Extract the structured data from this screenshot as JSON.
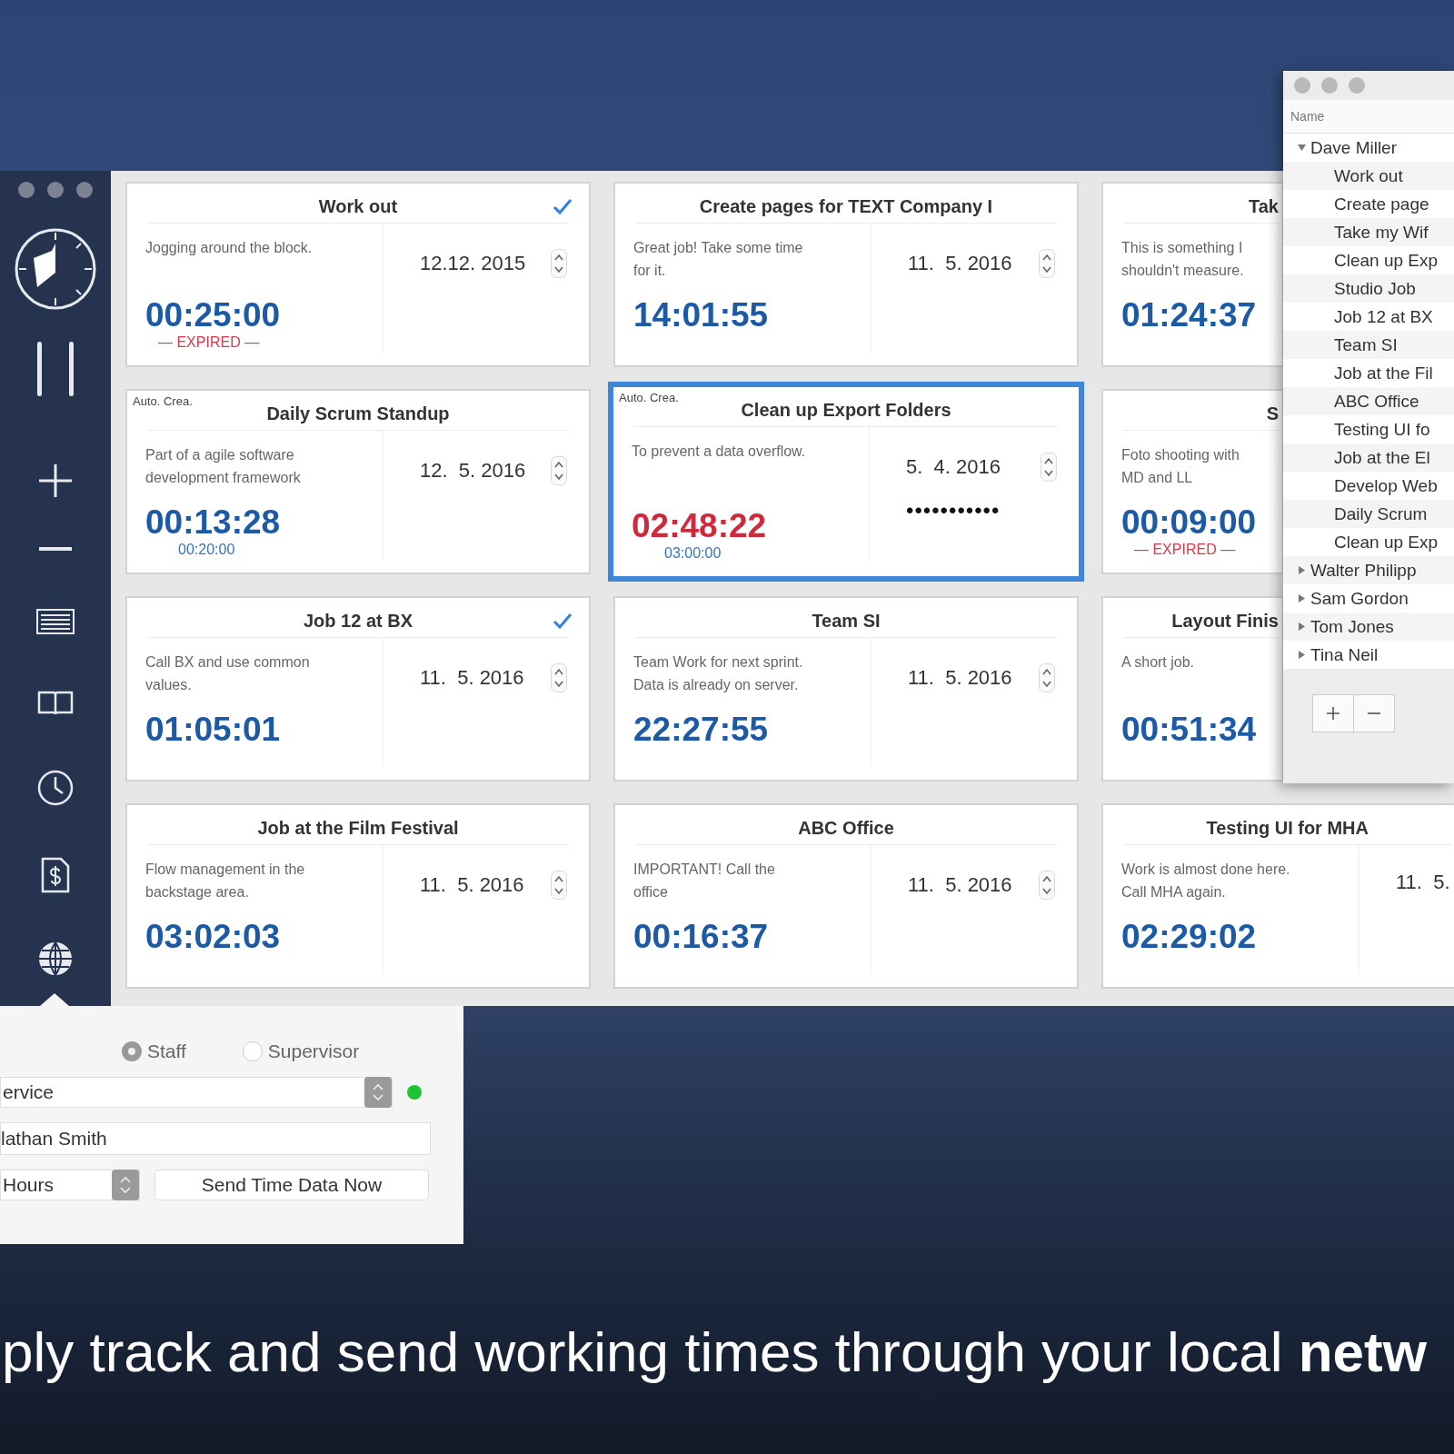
{
  "cards": [
    {
      "title": "Work out",
      "done": true,
      "selected": false,
      "description": "Jogging around the block.",
      "date": "12.12. 2015",
      "stepper": true,
      "time": "00:25:00",
      "overdue": false,
      "sub": {
        "kind": "expired",
        "text": "— EXPIRED —"
      }
    },
    {
      "title": "Create pages for TEXT Company I",
      "done": false,
      "selected": false,
      "description": "Great job! Take some time\nfor it.",
      "date": "11.  5. 2016",
      "stepper": true,
      "time": "14:01:55",
      "overdue": false
    },
    {
      "title": "Tak",
      "done": false,
      "selected": false,
      "description": "This is something I\nshouldn't measure.",
      "time": "01:24:37",
      "overdue": false
    },
    {
      "title": "Daily Scrum Standup",
      "tag": "Auto. Crea.",
      "done": false,
      "selected": false,
      "description": "Part of a agile software\ndevelopment framework",
      "date": "12.  5. 2016",
      "stepper": true,
      "time": "00:13:28",
      "overdue": false,
      "sub": {
        "kind": "target",
        "text": "00:20:00"
      }
    },
    {
      "title": "Clean up Export Folders",
      "tag": "Auto. Crea.",
      "done": false,
      "selected": true,
      "description": "To prevent a data overflow.",
      "date": "5.  4. 2016",
      "stepper": true,
      "secure_value": "•••••••••••",
      "time": "02:48:22",
      "overdue": true,
      "sub": {
        "kind": "target",
        "text": "03:00:00"
      }
    },
    {
      "title": "S",
      "done": false,
      "selected": false,
      "description": "Foto shooting with\nMD and LL",
      "time": "00:09:00",
      "overdue": false,
      "sub": {
        "kind": "expired",
        "text": "— EXPIRED —"
      }
    },
    {
      "title": "Job 12 at BX",
      "done": true,
      "selected": false,
      "description": "Call BX and use common\nvalues.",
      "date": "11.  5. 2016",
      "stepper": true,
      "time": "01:05:01",
      "overdue": false
    },
    {
      "title": "Team SI",
      "done": false,
      "selected": false,
      "description": "Team Work for next sprint.\nData is already on server.",
      "date": "11.  5. 2016",
      "stepper": true,
      "time": "22:27:55",
      "overdue": false
    },
    {
      "title": "Layout Finis",
      "done": false,
      "selected": false,
      "description": "A short job.",
      "time": "00:51:34",
      "overdue": false
    },
    {
      "title": "Job at the Film Festival",
      "done": false,
      "selected": false,
      "description": "Flow management in the\nbackstage area.",
      "date": "11.  5. 2016",
      "stepper": true,
      "time": "03:02:03",
      "overdue": false
    },
    {
      "title": "ABC Office",
      "done": false,
      "selected": false,
      "description": "IMPORTANT! Call the\noffice",
      "date": "11.  5. 2016",
      "stepper": true,
      "time": "00:16:37",
      "overdue": false
    },
    {
      "title": "Testing UI for MHA",
      "done": false,
      "selected": false,
      "description": "Work is almost done here.\nCall MHA again.",
      "date": "11.  5.",
      "stepper": false,
      "time": "02:29:02",
      "overdue": false
    }
  ],
  "tree": {
    "header": "Name",
    "items": [
      {
        "label": "Dave Miller",
        "expanded": true,
        "children": [
          {
            "label": "Work out"
          },
          {
            "label": "Create page"
          },
          {
            "label": "Take my Wif"
          },
          {
            "label": "Clean up Exp"
          },
          {
            "label": "Studio Job"
          },
          {
            "label": "Job 12 at BX"
          },
          {
            "label": "Team SI"
          },
          {
            "label": "Job at the Fil"
          },
          {
            "label": "ABC Office"
          },
          {
            "label": "Testing UI fo"
          },
          {
            "label": "Job at the El"
          },
          {
            "label": "Develop Web"
          },
          {
            "label": "Daily Scrum"
          },
          {
            "label": "Clean up Exp"
          }
        ]
      },
      {
        "label": "Walter Philipp",
        "expanded": false
      },
      {
        "label": "Sam Gordon",
        "expanded": false
      },
      {
        "label": "Tom Jones",
        "expanded": false
      },
      {
        "label": "Tina Neil",
        "expanded": false
      }
    ]
  },
  "popover": {
    "roles": [
      {
        "label": "Staff",
        "selected": true
      },
      {
        "label": "Supervisor",
        "selected": false
      }
    ],
    "service": {
      "value": "ervice",
      "connected": true
    },
    "name_field": {
      "value": "lathan Smith"
    },
    "unit": {
      "value": "Hours"
    },
    "send_button": "Send Time Data Now"
  },
  "tagline": "ply track and send working times through your local **netw**"
}
